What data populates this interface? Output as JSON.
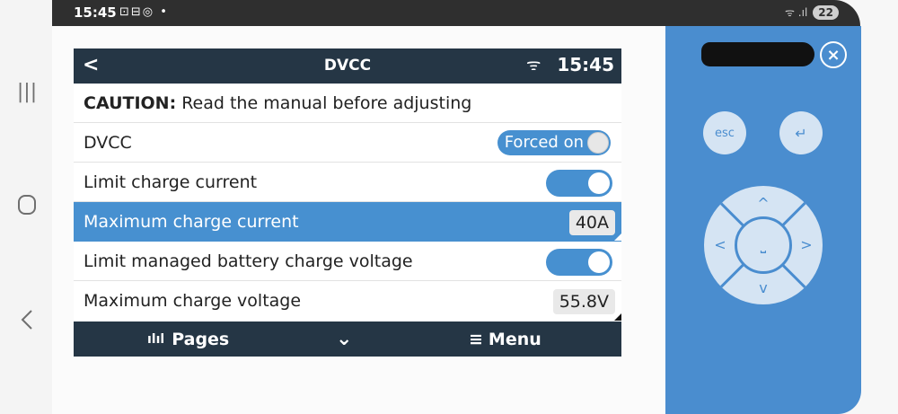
{
  "status_bar": {
    "time": "15:45",
    "notif_icons": "⊡⊟◎ •",
    "signal": "ᯤ .ıl",
    "battery": "22"
  },
  "device": {
    "header": {
      "back": "<",
      "title": "DVCC",
      "wifi": "ᯤ",
      "clock": "15:45"
    },
    "rows": [
      {
        "label_bold": "CAUTION:",
        "label": "Read the manual before adjusting"
      },
      {
        "label": "DVCC",
        "value": "Forced on"
      },
      {
        "label": "Limit charge current",
        "toggle": "on"
      },
      {
        "label": "Maximum charge current",
        "value": "40A",
        "selected": true
      },
      {
        "label": "Limit managed battery charge voltage",
        "toggle": "on"
      },
      {
        "label": "Maximum charge voltage",
        "value": "55.8V"
      }
    ],
    "footer": {
      "pages_icon": "ılıl",
      "pages": "Pages",
      "down": "⌄",
      "menu_icon": "≡",
      "menu": "Menu"
    }
  },
  "controls": {
    "close": "×",
    "esc": "esc",
    "enter": "↵",
    "center": "⎵",
    "up": "^",
    "down": "v",
    "left": "<",
    "right": ">"
  }
}
